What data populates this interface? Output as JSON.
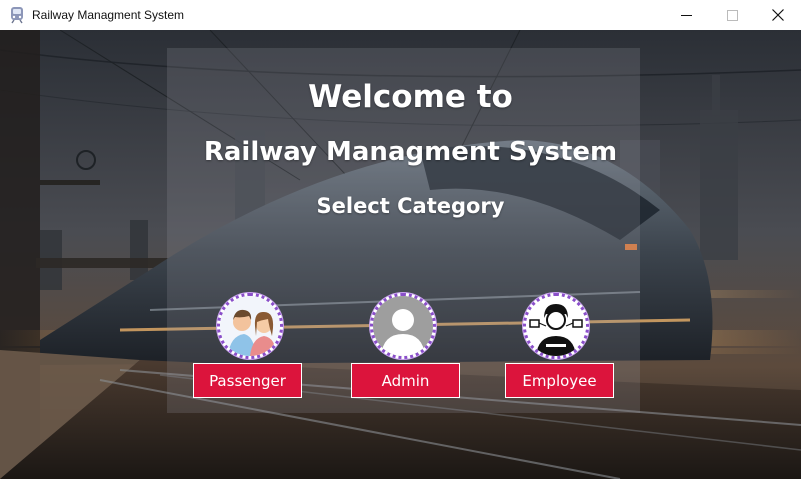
{
  "window": {
    "title": "Railway Managment System",
    "icon": "train-app-icon",
    "controls": [
      "minimize-icon",
      "maximize-icon",
      "close-icon"
    ]
  },
  "main": {
    "welcome": "Welcome to",
    "system_name": "Railway Managment System",
    "select_prompt": "Select Category"
  },
  "categories": [
    {
      "label": "Passenger",
      "icon": "passenger-avatar-icon"
    },
    {
      "label": "Admin",
      "icon": "admin-avatar-icon"
    },
    {
      "label": "Employee",
      "icon": "employee-avatar-icon"
    }
  ],
  "colors": {
    "button_bg": "#dc143c",
    "button_text": "#ffffff",
    "avatar_ring": "#8a4fc9"
  }
}
